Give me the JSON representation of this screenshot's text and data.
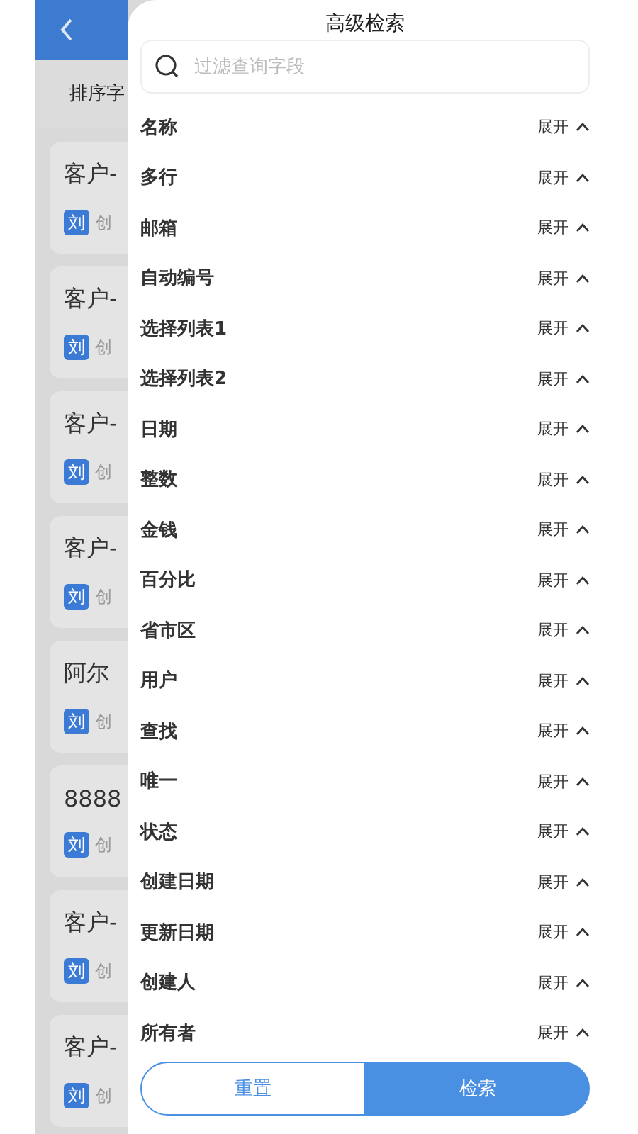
{
  "background": {
    "sort_bar": {
      "label": "排序字"
    },
    "cards": [
      {
        "title": "客户-",
        "avatar": "刘",
        "meta": "创"
      },
      {
        "title": "客户-",
        "avatar": "刘",
        "meta": "创"
      },
      {
        "title": "客户-",
        "avatar": "刘",
        "meta": "创"
      },
      {
        "title": "客户-",
        "avatar": "刘",
        "meta": "创"
      },
      {
        "title": "阿尔",
        "avatar": "刘",
        "meta": "创"
      },
      {
        "title": "8888",
        "avatar": "刘",
        "meta": "创"
      },
      {
        "title": "客户-",
        "avatar": "刘",
        "meta": "创"
      },
      {
        "title": "客户-",
        "avatar": "刘",
        "meta": "创"
      }
    ]
  },
  "panel": {
    "title": "高级检索",
    "search": {
      "placeholder": "过滤查询字段"
    },
    "fields": [
      {
        "label": "名称",
        "toggle": "展开"
      },
      {
        "label": "多行",
        "toggle": "展开"
      },
      {
        "label": "邮箱",
        "toggle": "展开"
      },
      {
        "label": "自动编号",
        "toggle": "展开"
      },
      {
        "label": "选择列表1",
        "toggle": "展开"
      },
      {
        "label": "选择列表2",
        "toggle": "展开"
      },
      {
        "label": "日期",
        "toggle": "展开"
      },
      {
        "label": "整数",
        "toggle": "展开"
      },
      {
        "label": "金钱",
        "toggle": "展开"
      },
      {
        "label": "百分比",
        "toggle": "展开"
      },
      {
        "label": "省市区",
        "toggle": "展开"
      },
      {
        "label": "用户",
        "toggle": "展开"
      },
      {
        "label": "查找",
        "toggle": "展开"
      },
      {
        "label": "唯一",
        "toggle": "展开"
      },
      {
        "label": "状态",
        "toggle": "展开"
      },
      {
        "label": "创建日期",
        "toggle": "展开"
      },
      {
        "label": "更新日期",
        "toggle": "展开"
      },
      {
        "label": "创建人",
        "toggle": "展开"
      },
      {
        "label": "所有者",
        "toggle": "展开"
      }
    ],
    "buttons": {
      "reset": "重置",
      "search": "检索"
    }
  }
}
